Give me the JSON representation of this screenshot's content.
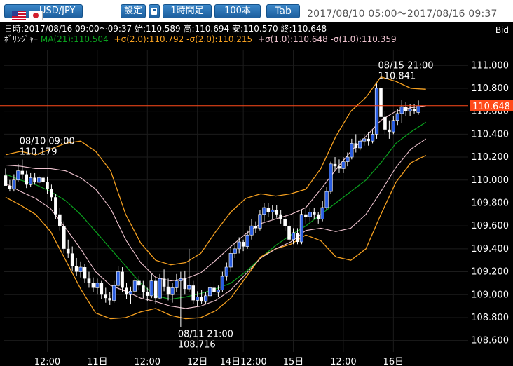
{
  "toolbar": {
    "symbol": "USD/JPY",
    "settings_label": "設定",
    "calculator_icon": "calculator-icon",
    "period_label": "1時間足",
    "amount_label": "100本",
    "tab_label": "Tab",
    "range_text": "2017/08/10 05:00〜2017/08/16 09:37"
  },
  "info": {
    "ohlc_text": "日時:2017/08/16 09:00〜09:37 始:110.589 高:110.694 安:110.570 終:110.648",
    "bollinger_prefix": "ﾎﾞﾘﾝｼﾞｬｰ",
    "ma_text": "MA(21):110.504",
    "s2_text": "+σ(2.0):110.792 -σ(2.0):110.215",
    "s1_text": "+σ(1.0):110.648 -σ(1.0):110.359",
    "price_type": "Bid"
  },
  "colors": {
    "background": "#000000",
    "up_candle": "#2a5de0",
    "down_candle": "#ffffff",
    "ma": "#0aa01e",
    "sigma2": "#f5a020",
    "sigma1": "#f0c4d0",
    "current_line": "#ff4a1a",
    "grid": "#1c1c1c",
    "text": "#ffffff"
  },
  "chart_data": {
    "type": "candlestick",
    "symbol": "USD/JPY",
    "timeframe": "1時間足",
    "ylim": [
      108.5,
      111.13
    ],
    "y_ticks": [
      "111.000",
      "110.800",
      "110.600",
      "110.400",
      "110.200",
      "110.000",
      "109.800",
      "109.600",
      "109.400",
      "109.200",
      "109.000",
      "108.800",
      "108.600"
    ],
    "y_tick_values": [
      111.0,
      110.8,
      110.6,
      110.4,
      110.2,
      110.0,
      109.8,
      109.6,
      109.4,
      109.2,
      109.0,
      108.8,
      108.6
    ],
    "x_ticks": [
      {
        "label": "12:00",
        "bar": 10
      },
      {
        "label": "11日",
        "bar": 22
      },
      {
        "label": "12:00",
        "bar": 34
      },
      {
        "label": "12日",
        "bar": 46
      },
      {
        "label": "14日12:00",
        "bar": 57
      },
      {
        "label": "15日",
        "bar": 69
      },
      {
        "label": "12:00",
        "bar": 81
      },
      {
        "label": "16日",
        "bar": 93
      }
    ],
    "current_price": "110.648",
    "current_value": 110.648,
    "annotations": [
      {
        "label": "08/10 09:00",
        "value": "110.179",
        "bar": 4,
        "price": 110.179,
        "position": "above"
      },
      {
        "label": "08/11 21:00",
        "value": "108.716",
        "bar": 42,
        "price": 108.716,
        "position": "below"
      },
      {
        "label": "08/15 21:00",
        "value": "110.841",
        "bar": 90,
        "price": 110.841,
        "position": "above"
      }
    ],
    "candles": [
      [
        110.04,
        110.1,
        109.98,
        109.95
      ],
      [
        109.95,
        110.0,
        109.9,
        109.92
      ],
      [
        109.92,
        110.05,
        109.9,
        110.0
      ],
      [
        110.0,
        110.14,
        109.98,
        110.08
      ],
      [
        110.08,
        110.179,
        110.01,
        110.05
      ],
      [
        110.05,
        110.08,
        109.93,
        109.96
      ],
      [
        109.96,
        110.06,
        109.94,
        110.02
      ],
      [
        110.02,
        110.06,
        109.96,
        109.98
      ],
      [
        109.98,
        110.04,
        109.95,
        110.02
      ],
      [
        110.02,
        110.04,
        109.95,
        109.98
      ],
      [
        109.98,
        110.03,
        109.88,
        109.92
      ],
      [
        109.92,
        109.96,
        109.82,
        109.85
      ],
      [
        109.85,
        109.88,
        109.66,
        109.7
      ],
      [
        109.7,
        109.76,
        109.56,
        109.6
      ],
      [
        109.6,
        109.64,
        109.36,
        109.4
      ],
      [
        109.4,
        109.48,
        109.32,
        109.36
      ],
      [
        109.36,
        109.42,
        109.21,
        109.25
      ],
      [
        109.25,
        109.32,
        109.16,
        109.2
      ],
      [
        109.2,
        109.29,
        109.15,
        109.24
      ],
      [
        109.24,
        109.27,
        109.1,
        109.14
      ],
      [
        109.14,
        109.2,
        109.06,
        109.1
      ],
      [
        109.1,
        109.15,
        109.02,
        109.06
      ],
      [
        109.06,
        109.14,
        109.0,
        109.1
      ],
      [
        109.1,
        109.12,
        108.96,
        109.0
      ],
      [
        109.0,
        109.06,
        108.93,
        108.97
      ],
      [
        108.97,
        109.02,
        108.91,
        108.95
      ],
      [
        108.95,
        109.12,
        108.93,
        109.08
      ],
      [
        109.08,
        109.25,
        109.04,
        109.2
      ],
      [
        109.2,
        109.24,
        109.02,
        109.06
      ],
      [
        109.06,
        109.1,
        108.96,
        109.0
      ],
      [
        109.0,
        109.07,
        108.92,
        109.03
      ],
      [
        109.03,
        109.16,
        109.0,
        109.12
      ],
      [
        109.12,
        109.16,
        109.04,
        109.08
      ],
      [
        109.08,
        109.12,
        108.97,
        109.02
      ],
      [
        109.02,
        109.06,
        108.94,
        108.99
      ],
      [
        108.99,
        109.18,
        108.97,
        109.12
      ],
      [
        109.12,
        109.14,
        108.92,
        108.97
      ],
      [
        108.97,
        109.18,
        108.96,
        109.14
      ],
      [
        109.14,
        109.22,
        109.03,
        109.07
      ],
      [
        109.07,
        109.14,
        108.95,
        109.0
      ],
      [
        109.0,
        109.1,
        108.93,
        109.06
      ],
      [
        109.06,
        109.18,
        109.02,
        109.12
      ],
      [
        109.12,
        109.2,
        108.716,
        109.14
      ],
      [
        109.14,
        109.21,
        109.0,
        109.05
      ],
      [
        109.05,
        109.4,
        109.02,
        109.08
      ],
      [
        109.08,
        109.12,
        108.92,
        108.95
      ],
      [
        108.95,
        109.03,
        108.9,
        108.98
      ],
      [
        108.98,
        109.04,
        108.92,
        108.94
      ],
      [
        108.94,
        109.02,
        108.92,
        108.99
      ],
      [
        108.99,
        109.1,
        108.96,
        109.06
      ],
      [
        109.06,
        109.12,
        109.0,
        109.02
      ],
      [
        109.02,
        109.08,
        108.98,
        109.04
      ],
      [
        109.04,
        109.2,
        109.02,
        109.16
      ],
      [
        109.16,
        109.28,
        109.12,
        109.24
      ],
      [
        109.24,
        109.42,
        109.2,
        109.36
      ],
      [
        109.36,
        109.45,
        109.32,
        109.4
      ],
      [
        109.4,
        109.5,
        109.36,
        109.46
      ],
      [
        109.46,
        109.48,
        109.38,
        109.42
      ],
      [
        109.42,
        109.56,
        109.4,
        109.52
      ],
      [
        109.52,
        109.66,
        109.48,
        109.6
      ],
      [
        109.6,
        109.64,
        109.54,
        109.58
      ],
      [
        109.58,
        109.74,
        109.56,
        109.7
      ],
      [
        109.7,
        109.8,
        109.64,
        109.76
      ],
      [
        109.76,
        109.8,
        109.68,
        109.72
      ],
      [
        109.72,
        109.78,
        109.66,
        109.74
      ],
      [
        109.74,
        109.78,
        109.67,
        109.7
      ],
      [
        109.7,
        109.74,
        109.62,
        109.66
      ],
      [
        109.66,
        109.7,
        109.56,
        109.6
      ],
      [
        109.6,
        109.64,
        109.44,
        109.48
      ],
      [
        109.48,
        109.58,
        109.44,
        109.54
      ],
      [
        109.54,
        109.58,
        109.44,
        109.46
      ],
      [
        109.46,
        109.74,
        109.44,
        109.7
      ],
      [
        109.7,
        109.76,
        109.62,
        109.68
      ],
      [
        109.68,
        109.76,
        109.64,
        109.72
      ],
      [
        109.72,
        109.76,
        109.66,
        109.7
      ],
      [
        109.7,
        109.72,
        109.62,
        109.66
      ],
      [
        109.66,
        109.82,
        109.64,
        109.76
      ],
      [
        109.76,
        109.94,
        109.74,
        109.9
      ],
      [
        109.9,
        110.16,
        109.88,
        110.14
      ],
      [
        110.14,
        110.2,
        110.08,
        110.12
      ],
      [
        110.12,
        110.18,
        110.06,
        110.1
      ],
      [
        110.1,
        110.2,
        110.06,
        110.16
      ],
      [
        110.16,
        110.24,
        110.12,
        110.2
      ],
      [
        110.2,
        110.36,
        110.18,
        110.32
      ],
      [
        110.32,
        110.4,
        110.24,
        110.28
      ],
      [
        110.28,
        110.36,
        110.26,
        110.34
      ],
      [
        110.34,
        110.4,
        110.3,
        110.36
      ],
      [
        110.36,
        110.42,
        110.3,
        110.34
      ],
      [
        110.34,
        110.44,
        110.32,
        110.4
      ],
      [
        110.4,
        110.841,
        110.36,
        110.8
      ],
      [
        110.8,
        110.82,
        110.5,
        110.55
      ],
      [
        110.55,
        110.6,
        110.4,
        110.44
      ],
      [
        110.44,
        110.52,
        110.36,
        110.42
      ],
      [
        110.42,
        110.56,
        110.4,
        110.52
      ],
      [
        110.52,
        110.62,
        110.48,
        110.58
      ],
      [
        110.58,
        110.7,
        110.5,
        110.64
      ],
      [
        110.64,
        110.68,
        110.56,
        110.6
      ],
      [
        110.6,
        110.66,
        110.56,
        110.62
      ],
      [
        110.62,
        110.66,
        110.58,
        110.6
      ],
      [
        110.589,
        110.694,
        110.57,
        110.648
      ]
    ],
    "bands": {
      "ma21": [
        110.05,
        110.0,
        109.96,
        109.9,
        109.82,
        109.7,
        109.55,
        109.4,
        109.25,
        109.1,
        108.99,
        108.96,
        108.98,
        109.01,
        109.05,
        109.1,
        109.2,
        109.32,
        109.43,
        109.52,
        109.6,
        109.7,
        109.8,
        109.9,
        110.0,
        110.15,
        110.32,
        110.42,
        110.504
      ],
      "up2": [
        110.22,
        110.25,
        110.22,
        110.27,
        110.32,
        110.34,
        110.25,
        110.08,
        109.7,
        109.45,
        109.3,
        109.26,
        109.28,
        109.36,
        109.55,
        109.72,
        109.84,
        109.88,
        109.86,
        109.88,
        109.92,
        110.1,
        110.38,
        110.6,
        110.72,
        110.9,
        110.86,
        110.8,
        110.792
      ],
      "lo2": [
        109.85,
        109.78,
        109.7,
        109.55,
        109.3,
        109.05,
        108.84,
        108.79,
        108.8,
        108.85,
        108.88,
        108.82,
        108.79,
        108.8,
        108.86,
        108.97,
        109.15,
        109.33,
        109.4,
        109.44,
        109.52,
        109.47,
        109.33,
        109.3,
        109.4,
        109.7,
        109.98,
        110.15,
        110.215
      ],
      "up1": [
        110.13,
        110.12,
        110.1,
        110.1,
        110.08,
        110.02,
        109.92,
        109.75,
        109.48,
        109.28,
        109.15,
        109.12,
        109.14,
        109.19,
        109.3,
        109.42,
        109.53,
        109.62,
        109.66,
        109.7,
        109.76,
        109.92,
        110.09,
        110.25,
        110.38,
        110.52,
        110.6,
        110.63,
        110.648
      ],
      "lo1": [
        109.97,
        109.9,
        109.84,
        109.75,
        109.58,
        109.4,
        109.2,
        109.08,
        109.03,
        108.97,
        108.94,
        108.9,
        108.88,
        108.9,
        108.95,
        109.04,
        109.18,
        109.32,
        109.4,
        109.46,
        109.56,
        109.58,
        109.55,
        109.58,
        109.7,
        109.9,
        110.11,
        110.27,
        110.359
      ]
    },
    "band_step": 3.6
  }
}
